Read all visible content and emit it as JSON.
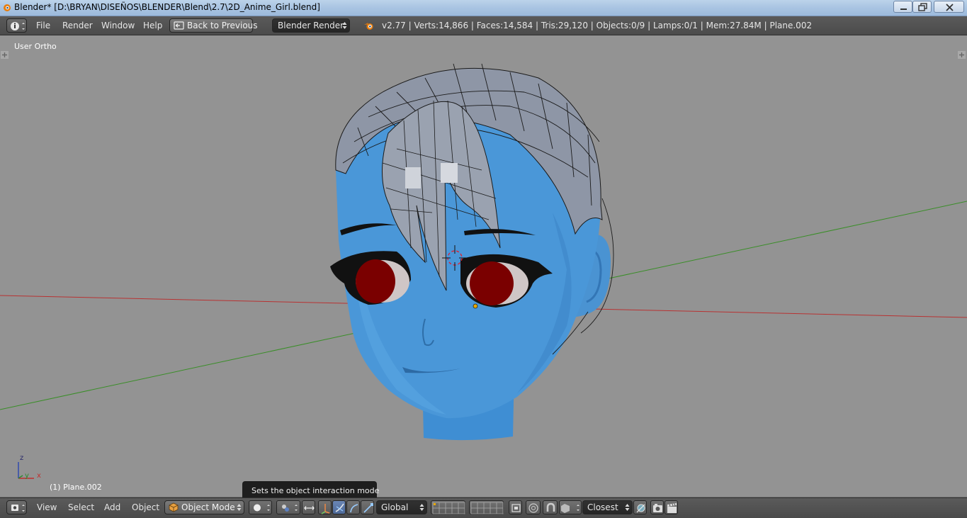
{
  "window": {
    "title": "Blender* [D:\\BRYAN\\DISEÑOS\\BLENDER\\Blend\\2.7\\2D_Anime_Girl.blend]",
    "controls": [
      "minimize",
      "restore",
      "close"
    ]
  },
  "info_header": {
    "menus": [
      "File",
      "Render",
      "Window",
      "Help"
    ],
    "back_button": "Back to Previous",
    "render_engine": "Blender Render",
    "stats": "v2.77 | Verts:14,866 | Faces:14,584 | Tris:29,120 | Objects:0/9 | Lamps:0/1 | Mem:27.84M | Plane.002"
  },
  "viewport": {
    "view_label": "User Ortho",
    "object_label": "(1) Plane.002",
    "axes": {
      "z": "z",
      "y": "y",
      "x": "x"
    },
    "tooltip": "Sets the object interaction mode",
    "colors": {
      "background": "#939393",
      "skin": "#4a97d8",
      "hair": "#8e96a6",
      "iris": "#7a0000",
      "x_axis": "#b83232",
      "y_axis": "#3a8e28"
    }
  },
  "view3d_header": {
    "menus": [
      "View",
      "Select",
      "Add",
      "Object"
    ],
    "mode": "Object Mode",
    "orientation": "Global",
    "snap_target": "Closest"
  }
}
